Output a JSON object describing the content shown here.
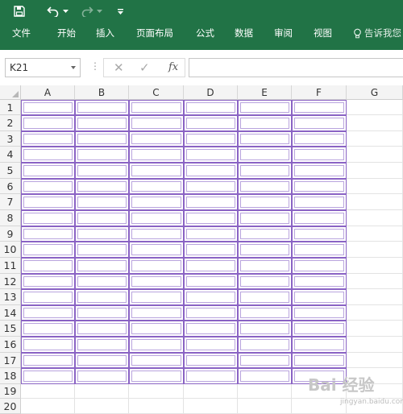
{
  "colors": {
    "ribbon_green": "#217346",
    "cell_border": "#8a63c4",
    "header_bg": "#f4f4f4"
  },
  "quick_access": {
    "save_icon": "save-icon",
    "undo_icon": "undo-icon",
    "redo_icon": "redo-icon",
    "customize_icon": "customize-icon"
  },
  "menu": {
    "tabs": [
      "文件",
      "开始",
      "插入",
      "页面布局",
      "公式",
      "数据",
      "审阅",
      "视图"
    ],
    "tell_me": "告诉我您"
  },
  "formula_bar": {
    "name_box": "K21",
    "fx_label": "fx",
    "value": ""
  },
  "grid": {
    "columns": [
      "A",
      "B",
      "C",
      "D",
      "E",
      "F",
      "G"
    ],
    "rows": [
      "1",
      "2",
      "3",
      "4",
      "5",
      "6",
      "7",
      "8",
      "9",
      "10",
      "11",
      "12",
      "13",
      "14",
      "15",
      "16",
      "17",
      "18",
      "19",
      "20"
    ],
    "bordered_columns": [
      "A",
      "B",
      "C",
      "D",
      "E",
      "F"
    ],
    "bordered_rows": [
      "1",
      "2",
      "3",
      "4",
      "5",
      "6",
      "7",
      "8",
      "9",
      "10",
      "11",
      "12",
      "13",
      "14",
      "15",
      "16",
      "17",
      "18"
    ]
  },
  "watermark": {
    "logo": "Bai 经验",
    "sub": "jingyan.baidu.com"
  }
}
